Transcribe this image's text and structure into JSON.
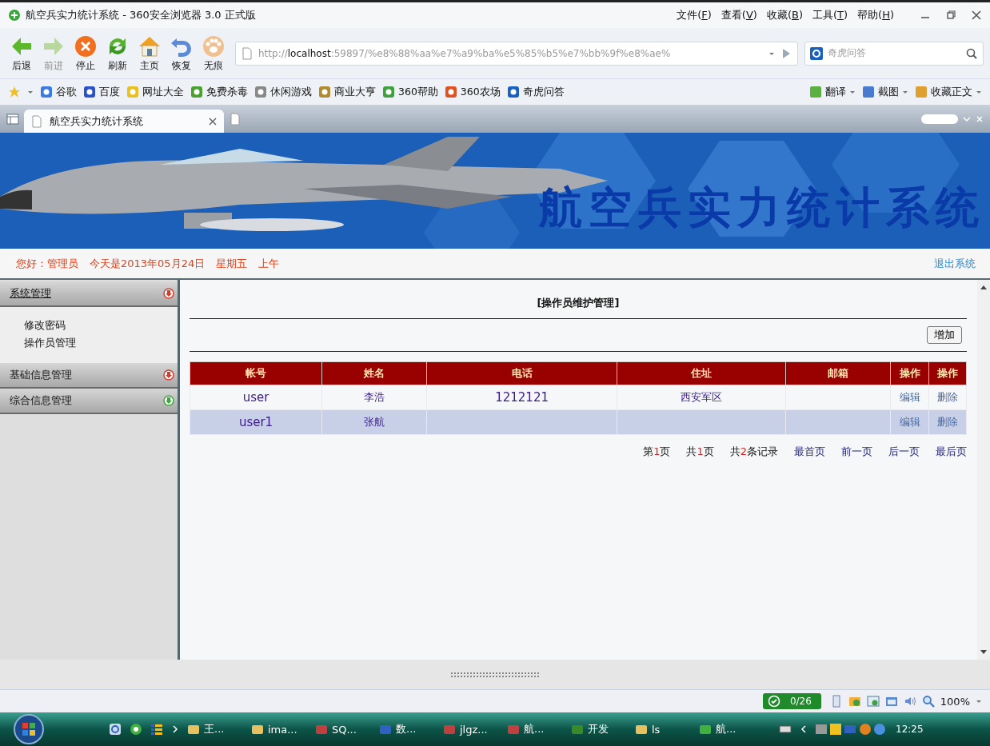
{
  "window": {
    "title": "航空兵实力统计系统 - 360安全浏览器 3.0 正式版"
  },
  "menu": [
    {
      "before": "文件(",
      "key": "F",
      "after": ")"
    },
    {
      "before": "查看(",
      "key": "V",
      "after": ")"
    },
    {
      "before": "收藏(",
      "key": "B",
      "after": ")"
    },
    {
      "before": "工具(",
      "key": "T",
      "after": ")"
    },
    {
      "before": "帮助(",
      "key": "H",
      "after": ")"
    }
  ],
  "toolbar": [
    {
      "kind": "back",
      "label": "后退",
      "disabled": false
    },
    {
      "kind": "forward",
      "label": "前进",
      "disabled": true
    },
    {
      "kind": "stop",
      "label": "停止",
      "disabled": false
    },
    {
      "kind": "refresh",
      "label": "刷新",
      "disabled": false
    },
    {
      "kind": "home",
      "label": "主页",
      "disabled": false
    },
    {
      "kind": "restore",
      "label": "恢复",
      "disabled": false
    },
    {
      "kind": "incognito",
      "label": "无痕",
      "disabled": false
    }
  ],
  "address": {
    "scheme": "http://",
    "host": "localhost",
    "rest": ":59897/%e8%88%aa%e7%a9%ba%e5%85%b5%e7%bb%9f%e8%ae%"
  },
  "search": {
    "placeholder": "奇虎问答"
  },
  "bookmarks": [
    "谷歌",
    "百度",
    "网址大全",
    "免费杀毒",
    "休闲游戏",
    "商业大亨",
    "360帮助",
    "360农场",
    "奇虎问答"
  ],
  "tools": [
    "翻译",
    "截图",
    "收藏正文"
  ],
  "tab": {
    "title": "航空兵实力统计系统"
  },
  "banner": {
    "title": "航空兵实力统计系统"
  },
  "greeting": {
    "hello": "您好：管理员",
    "date": "今天是2013年05月24日",
    "weekday": "星期五",
    "period": "上午",
    "logout": "退出系统"
  },
  "sidebar": [
    {
      "title": "系统管理",
      "color": "#d83a2a",
      "expanded": true,
      "items": [
        "修改密码",
        "操作员管理"
      ]
    },
    {
      "title": "基础信息管理",
      "color": "#d83a2a",
      "expanded": false
    },
    {
      "title": "综合信息管理",
      "color": "#3aa83a",
      "expanded": false
    }
  ],
  "content": {
    "heading": "[操作员维护管理]",
    "add_button": "增加"
  },
  "table": {
    "columns": [
      "帐号",
      "姓名",
      "电话",
      "住址",
      "邮箱",
      "操作",
      "操作"
    ],
    "rows": [
      {
        "account": "user",
        "name": "李浩",
        "phone": "1212121",
        "address": "西安军区",
        "actions": [
          "编辑",
          "删除"
        ],
        "selected": false
      },
      {
        "account": "user1",
        "name": "张航",
        "actions": [
          "编辑",
          "删除"
        ],
        "selected": true
      }
    ]
  },
  "pagination": {
    "info": [
      {
        "before": "第",
        "value": "1",
        "after": "页"
      },
      {
        "before": "共",
        "value": "1",
        "after": "页"
      },
      {
        "before": "共",
        "value": "2",
        "after": "条记录"
      }
    ],
    "links": [
      "最首页",
      "前一页",
      "后一页",
      "最后页"
    ]
  },
  "status_bar": {
    "counter": "0/26",
    "zoom": "100%"
  },
  "taskbar": {
    "items": [
      {
        "kind": "folder",
        "label": "王..."
      },
      {
        "kind": "folder",
        "label": "ima..."
      },
      {
        "kind": "app",
        "label": "SQ..."
      },
      {
        "kind": "doc",
        "label": "数..."
      },
      {
        "kind": "app",
        "label": "jlgz..."
      },
      {
        "kind": "app",
        "label": "航..."
      },
      {
        "kind": "tree",
        "label": "开发"
      },
      {
        "kind": "folder",
        "label": "ls"
      },
      {
        "kind": "browser",
        "label": "航..."
      }
    ],
    "clock": "12:25"
  }
}
